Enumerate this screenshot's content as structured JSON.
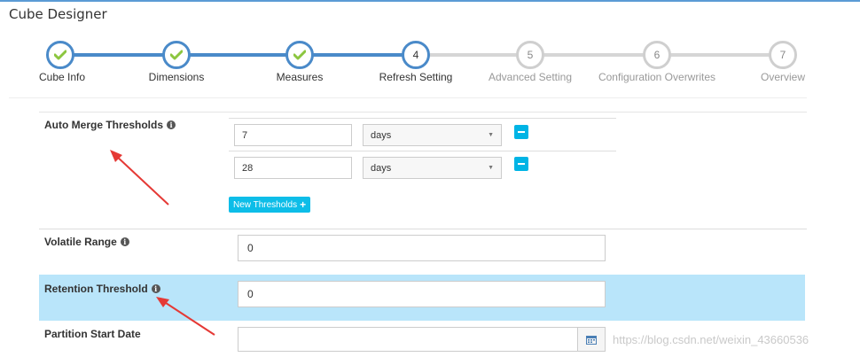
{
  "app": {
    "title": "Cube Designer"
  },
  "wizard": {
    "steps": [
      {
        "number": "1",
        "label": "Cube Info",
        "state": "done"
      },
      {
        "number": "2",
        "label": "Dimensions",
        "state": "done"
      },
      {
        "number": "3",
        "label": "Measures",
        "state": "done"
      },
      {
        "number": "4",
        "label": "Refresh Setting",
        "state": "current"
      },
      {
        "number": "5",
        "label": "Advanced Setting",
        "state": "future"
      },
      {
        "number": "6",
        "label": "Configuration Overwrites",
        "state": "future"
      },
      {
        "number": "7",
        "label": "Overview",
        "state": "future"
      }
    ]
  },
  "auto_merge": {
    "label": "Auto Merge Thresholds",
    "thresholds": [
      {
        "value": "7",
        "unit": "days"
      },
      {
        "value": "28",
        "unit": "days"
      }
    ],
    "new_button_label": "New Thresholds"
  },
  "volatile_range": {
    "label": "Volatile Range",
    "value": "0"
  },
  "retention_threshold": {
    "label": "Retention Threshold",
    "value": "0"
  },
  "partition_start_date": {
    "label": "Partition Start Date",
    "value": ""
  },
  "watermark": "https://blog.csdn.net/weixin_43660536",
  "colors": {
    "accent": "#4a8ac9",
    "button": "#0dbde8",
    "highlight": "#b9e5fa",
    "arrow": "#e53935"
  },
  "info_icon": "i"
}
